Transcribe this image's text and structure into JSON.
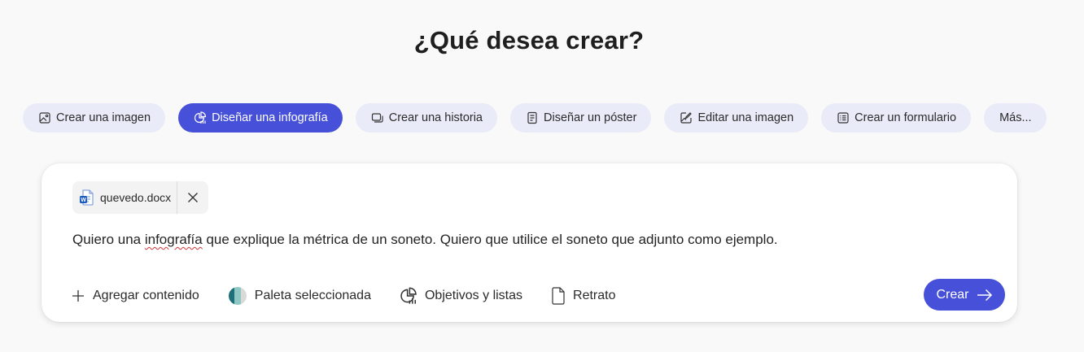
{
  "heading": "¿Qué desea crear?",
  "chips": [
    {
      "label": "Crear una imagen",
      "icon": "image-icon",
      "active": false
    },
    {
      "label": "Diseñar una infografía",
      "icon": "infographic-icon",
      "active": true
    },
    {
      "label": "Crear una historia",
      "icon": "story-icon",
      "active": false
    },
    {
      "label": "Diseñar un póster",
      "icon": "poster-icon",
      "active": false
    },
    {
      "label": "Editar una imagen",
      "icon": "edit-image-icon",
      "active": false
    },
    {
      "label": "Crear un formulario",
      "icon": "form-icon",
      "active": false
    },
    {
      "label": "Más...",
      "icon": "",
      "active": false
    }
  ],
  "attachment": {
    "file_name": "quevedo.docx",
    "icon": "word-file-icon"
  },
  "prompt": {
    "before": "Quiero una ",
    "misspelled": "infografía",
    "after": " que explique la métrica de un soneto. Quiero que utilice el soneto que adjunto como ejemplo."
  },
  "tools": {
    "add_content": "Agregar contenido",
    "palette": "Paleta seleccionada",
    "goals": "Objetivos y listas",
    "orientation": "Retrato"
  },
  "create_button": "Crear",
  "colors": {
    "accent": "#4650d8",
    "chip_bg": "#e9ebf8",
    "page_bg": "#f9f9f9"
  }
}
